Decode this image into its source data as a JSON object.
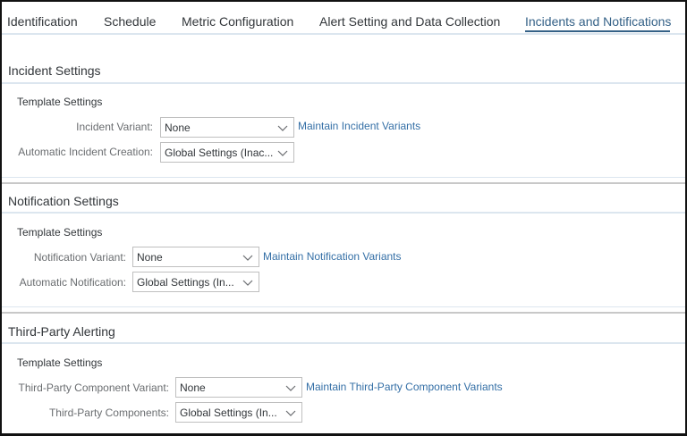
{
  "tabs": [
    {
      "label": "Identification"
    },
    {
      "label": "Schedule"
    },
    {
      "label": "Metric Configuration"
    },
    {
      "label": "Alert Setting and Data Collection"
    },
    {
      "label": "Incidents and Notifications",
      "active": true
    }
  ],
  "incident": {
    "title": "Incident Settings",
    "subtitle": "Template Settings",
    "variant_label": "Incident Variant:",
    "variant_value": "None",
    "variant_link": "Maintain Incident Variants",
    "auto_label": "Automatic Incident Creation:",
    "auto_value": "Global Settings (Inac..."
  },
  "notification": {
    "title": "Notification Settings",
    "subtitle": "Template Settings",
    "variant_label": "Notification Variant:",
    "variant_value": "None",
    "variant_link": "Maintain Notification Variants",
    "auto_label": "Automatic Notification:",
    "auto_value": "Global Settings (In..."
  },
  "thirdparty": {
    "title": "Third-Party Alerting",
    "subtitle": "Template Settings",
    "variant_label": "Third-Party Component Variant:",
    "variant_value": "None",
    "variant_link": "Maintain Third-Party Component Variants",
    "comp_label": "Third-Party Components:",
    "comp_value": "Global Settings (In..."
  }
}
